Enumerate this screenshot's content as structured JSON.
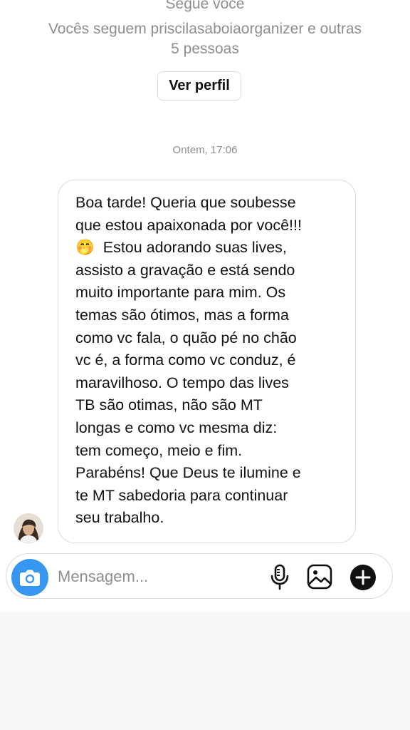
{
  "header": {
    "follows_you": "Segue você",
    "mutual_followers_line1": "Vocês seguem priscilasaboiaorganizer e outras",
    "mutual_followers_line2": "5 pessoas",
    "view_profile_label": "Ver perfil"
  },
  "conversation": {
    "timestamp": "Ontem, 17:06",
    "message": {
      "text_part1": "Boa tarde! Queria que soubesse\nque estou apaixonada por você!!!\n",
      "emoji": "🤭",
      "text_part2": "  Estou adorando suas lives,\nassisto a gravação e está sendo\nmuito importante para mim. Os\ntemas são ótimos, mas a forma\ncomo vc fala, o quão pé no chão\nvc é, a forma como vc conduz, é\nmaravilhoso. O tempo das lives\nTB são otimas, não são MT\nlongas e como vc mesma diz:\ntem começo, meio e fim.\nParabéns! Que Deus te ilumine e\nte MT sabedoria para continuar\nseu trabalho."
    }
  },
  "composer": {
    "placeholder": "Mensagem...",
    "icons": {
      "camera": "camera-icon",
      "mic": "microphone-icon",
      "gallery": "gallery-icon",
      "plus": "plus-circle-icon"
    }
  },
  "colors": {
    "accent": "#3797f0",
    "muted_text": "#8e8e8e",
    "border": "#dbdbdb"
  }
}
